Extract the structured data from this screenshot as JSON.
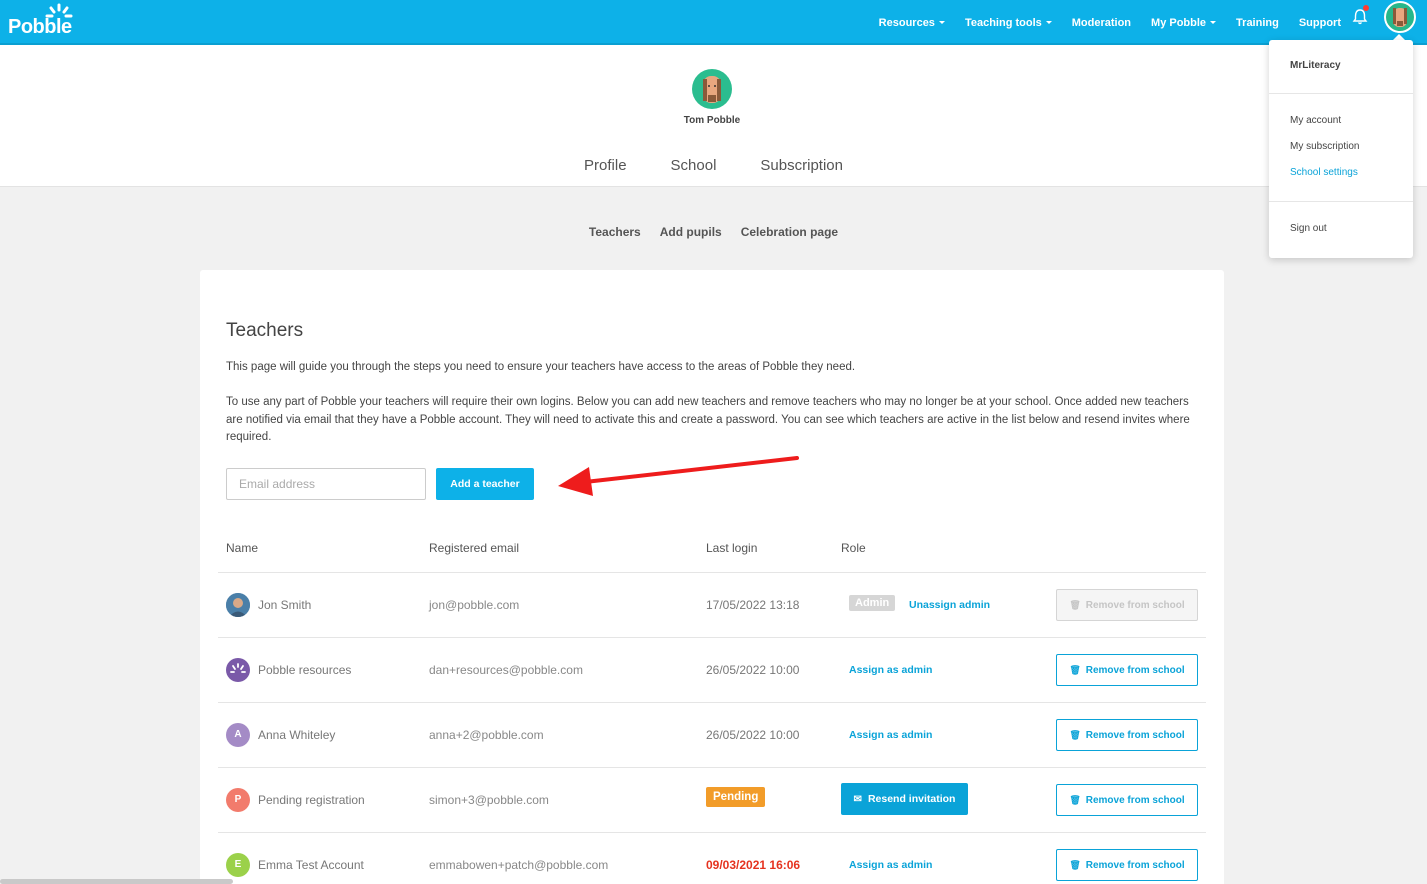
{
  "navbar": {
    "logo": "Pobble",
    "items": [
      {
        "label": "Resources",
        "caret": true
      },
      {
        "label": "Teaching tools",
        "caret": true
      },
      {
        "label": "Moderation",
        "caret": false
      },
      {
        "label": "My Pobble",
        "caret": true
      },
      {
        "label": "Training",
        "caret": false
      },
      {
        "label": "Support",
        "caret": false
      }
    ],
    "icons": [
      "bell-icon",
      "user-avatar"
    ]
  },
  "header": {
    "user_name": "Tom Pobble",
    "tabs": [
      "Profile",
      "School",
      "Subscription"
    ]
  },
  "subnav": [
    "Teachers",
    "Add pupils",
    "Celebration page"
  ],
  "teachers": {
    "title": "Teachers",
    "intro": "This page will guide you through the steps you need to ensure your teachers have access to the areas of Pobble they need.",
    "description": "To use any part of Pobble your teachers will require their own logins. Below you can add new teachers and remove teachers who may no longer be at your school. Once added new teachers are notified via email that they have a Pobble account. They will need to activate this and create a password. You can see which teachers are active in the list below and resend invites where required.",
    "email_placeholder": "Email address",
    "add_button": "Add a teacher",
    "columns": [
      "Name",
      "Registered email",
      "Last login",
      "Role"
    ],
    "rows": [
      {
        "name": "Jon Smith",
        "email": "jon@pobble.com",
        "last_login": "17/05/2022 13:18",
        "admin_badge": "Admin",
        "role_action": "Unassign admin",
        "remove": "Remove from school",
        "remove_disabled": true,
        "avatar": "photo"
      },
      {
        "name": "Pobble resources",
        "email": "dan+resources@pobble.com",
        "last_login": "26/05/2022 10:00",
        "role_action": "Assign as admin",
        "remove": "Remove from school",
        "avatar": "pobble-logo"
      },
      {
        "name": "Anna Whiteley",
        "email": "anna+2@pobble.com",
        "last_login": "26/05/2022 10:00",
        "role_action": "Assign as admin",
        "remove": "Remove from school",
        "avatar_letter": "A",
        "avatar_color": "#a48bc6"
      },
      {
        "name": "Pending registration",
        "email": "simon+3@pobble.com",
        "status": "Pending",
        "role_action": "Resend invitation",
        "remove": "Remove from school",
        "avatar_letter": "P",
        "avatar_color": "#f27b6c"
      },
      {
        "name": "Emma Test Account",
        "email": "emmabowen+patch@pobble.com",
        "last_login": "09/03/2021 16:06",
        "last_login_overdue": true,
        "role_action": "Assign as admin",
        "remove": "Remove from school",
        "avatar_letter": "E",
        "avatar_color": "#9bd14a"
      }
    ]
  },
  "dropdown": {
    "username": "MrLiteracy",
    "items": [
      "My account",
      "My subscription",
      "School settings"
    ],
    "active": "School settings",
    "sign_out": "Sign out"
  },
  "colors": {
    "brand": "#0db1e8",
    "link": "#0aa3d8",
    "pending": "#f29c29",
    "overdue": "#e5331f"
  }
}
